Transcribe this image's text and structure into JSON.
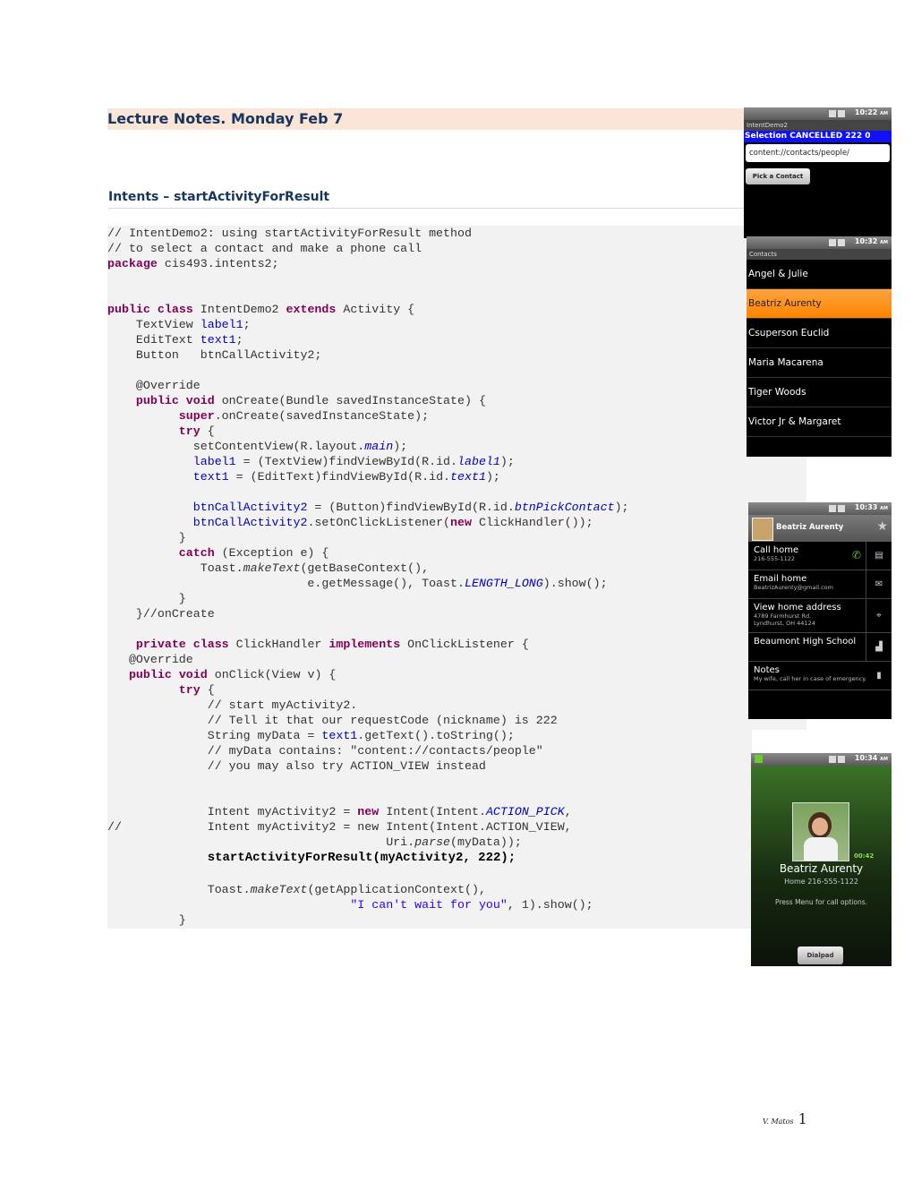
{
  "heading": "Lecture Notes. Monday Feb 7",
  "subheading": "Intents – startActivityForResult",
  "code": {
    "l1": "// IntentDemo2: using startActivityForResult method",
    "l2": "// to select a contact and make a phone call",
    "l3a": "package",
    "l3b": " cis493.intents2;",
    "l4a": "public",
    "l4b": " ",
    "l4c": "class",
    "l4d": " IntentDemo2 ",
    "l4e": "extends",
    "l4f": " Activity {",
    "l5a": "    TextView ",
    "l5b": "label1",
    "l5c": ";",
    "l6a": "    EditText ",
    "l6b": "text1",
    "l6c": ";",
    "l7": "    Button   btnCallActivity2;",
    "l8": "    @Override",
    "l9a": "    ",
    "l9b": "public",
    "l9c": " ",
    "l9d": "void",
    "l9e": " onCreate(Bundle savedInstanceState) {",
    "l10a": "          ",
    "l10b": "super",
    "l10c": ".onCreate(savedInstanceState);",
    "l11a": "          ",
    "l11b": "try",
    "l11c": " {",
    "l12a": "            setContentView(R.layout.",
    "l12b": "main",
    "l12c": ");",
    "l13a": "            ",
    "l13b": "label1",
    "l13c": " = (TextView)findViewById(R.id.",
    "l13d": "label1",
    "l13e": ");",
    "l14a": "            ",
    "l14b": "text1",
    "l14c": " = (EditText)findViewById(R.id.",
    "l14d": "text1",
    "l14e": ");",
    "l15a": "            ",
    "l15b": "btnCallActivity2",
    "l15c": " = (Button)findViewById(R.id.",
    "l15d": "btnPickContact",
    "l15e": ");",
    "l16a": "            ",
    "l16b": "btnCallActivity2",
    "l16c": ".setOnClickListener(",
    "l16d": "new",
    "l16e": " ClickHandler());",
    "l17": "          }",
    "l18a": "          ",
    "l18b": "catch",
    "l18c": " (Exception e) {",
    "l19a": "             Toast.",
    "l19b": "makeText",
    "l19c": "(getBaseContext(),",
    "l20a": "                            e.getMessage(), Toast.",
    "l20b": "LENGTH_LONG",
    "l20c": ").show();",
    "l21": "          }",
    "l22": "    }//onCreate",
    "l23a": "    ",
    "l23b": "private",
    "l23c": " ",
    "l23d": "class",
    "l23e": " ClickHandler ",
    "l23f": "implements",
    "l23g": " OnClickListener {",
    "l24": "   @Override",
    "l25a": "   ",
    "l25b": "public",
    "l25c": " ",
    "l25d": "void",
    "l25e": " onClick(View v) {",
    "l26a": "          ",
    "l26b": "try",
    "l26c": " {",
    "l27": "              // start myActivity2.",
    "l28": "              // Tell it that our requestCode (nickname) is 222",
    "l29a": "              String myData = ",
    "l29b": "text1",
    "l29c": ".getText().toString();",
    "l30": "              // myData contains: \"content://contacts/people\"",
    "l31": "              // you may also try ACTION_VIEW instead",
    "l32a": "              Intent myActivity2 = ",
    "l32b": "new",
    "l32c": " Intent(Intent.",
    "l32d": "ACTION_PICK",
    "l32e": ",",
    "l33": "//            Intent myActivity2 = new Intent(Intent.ACTION_VIEW,",
    "l34a": "                                       Uri.",
    "l34b": "parse",
    "l34c": "(myData));",
    "l35a": "              ",
    "l35b": "startActivityForResult(myActivity2, 222);",
    "l36a": "              Toast.",
    "l36b": "makeText",
    "l36c": "(getApplicationContext(),",
    "l37a": "                                  ",
    "l37b": "\"I can't wait for you\"",
    "l37c": ", 1).show();",
    "l38": "          }"
  },
  "phone1": {
    "time": "10:22",
    "ampm": "AM",
    "app_title": "IntentDemo2",
    "status_text": "Selection CANCELLED 222 0",
    "input_value": "content://contacts/people/",
    "button_label": "Pick a Contact"
  },
  "phone2": {
    "time": "10:32",
    "ampm": "AM",
    "app_title": "Contacts",
    "contacts": [
      "Angel & Julie",
      "Beatriz Aurenty",
      "Csuperson Euclid",
      "Maria Macarena",
      "Tiger Woods",
      "Victor Jr &  Margaret"
    ]
  },
  "phone3": {
    "time": "10:33",
    "ampm": "AM",
    "name": "Beatriz Aurenty",
    "rows": [
      {
        "title": "Call home",
        "sub": "216-555-1122"
      },
      {
        "title": "Email home",
        "sub": "BeatrizAurenty@gmail.com"
      },
      {
        "title": "View home address",
        "sub": "4789 Farmhurst Rd. Lyndhurst, OH 44124"
      },
      {
        "title": "Beaumont High School",
        "sub": ""
      },
      {
        "title": "Notes",
        "sub": "My wife, call her in case of emergency."
      }
    ]
  },
  "phone4": {
    "time": "10:34",
    "ampm": "AM",
    "timer": "00:42",
    "name": "Beatriz Aurenty",
    "sub": "Home 216-555-1122",
    "hint": "Press Menu for call options.",
    "button_label": "Dialpad"
  },
  "footer": {
    "author": "V. Matos",
    "page": "1"
  },
  "colors": {
    "title_bg": "#fbe5d6",
    "keyword": "#7f0055",
    "field": "#0000c0",
    "string": "#2a00ff",
    "selected": "#ff8c00"
  }
}
